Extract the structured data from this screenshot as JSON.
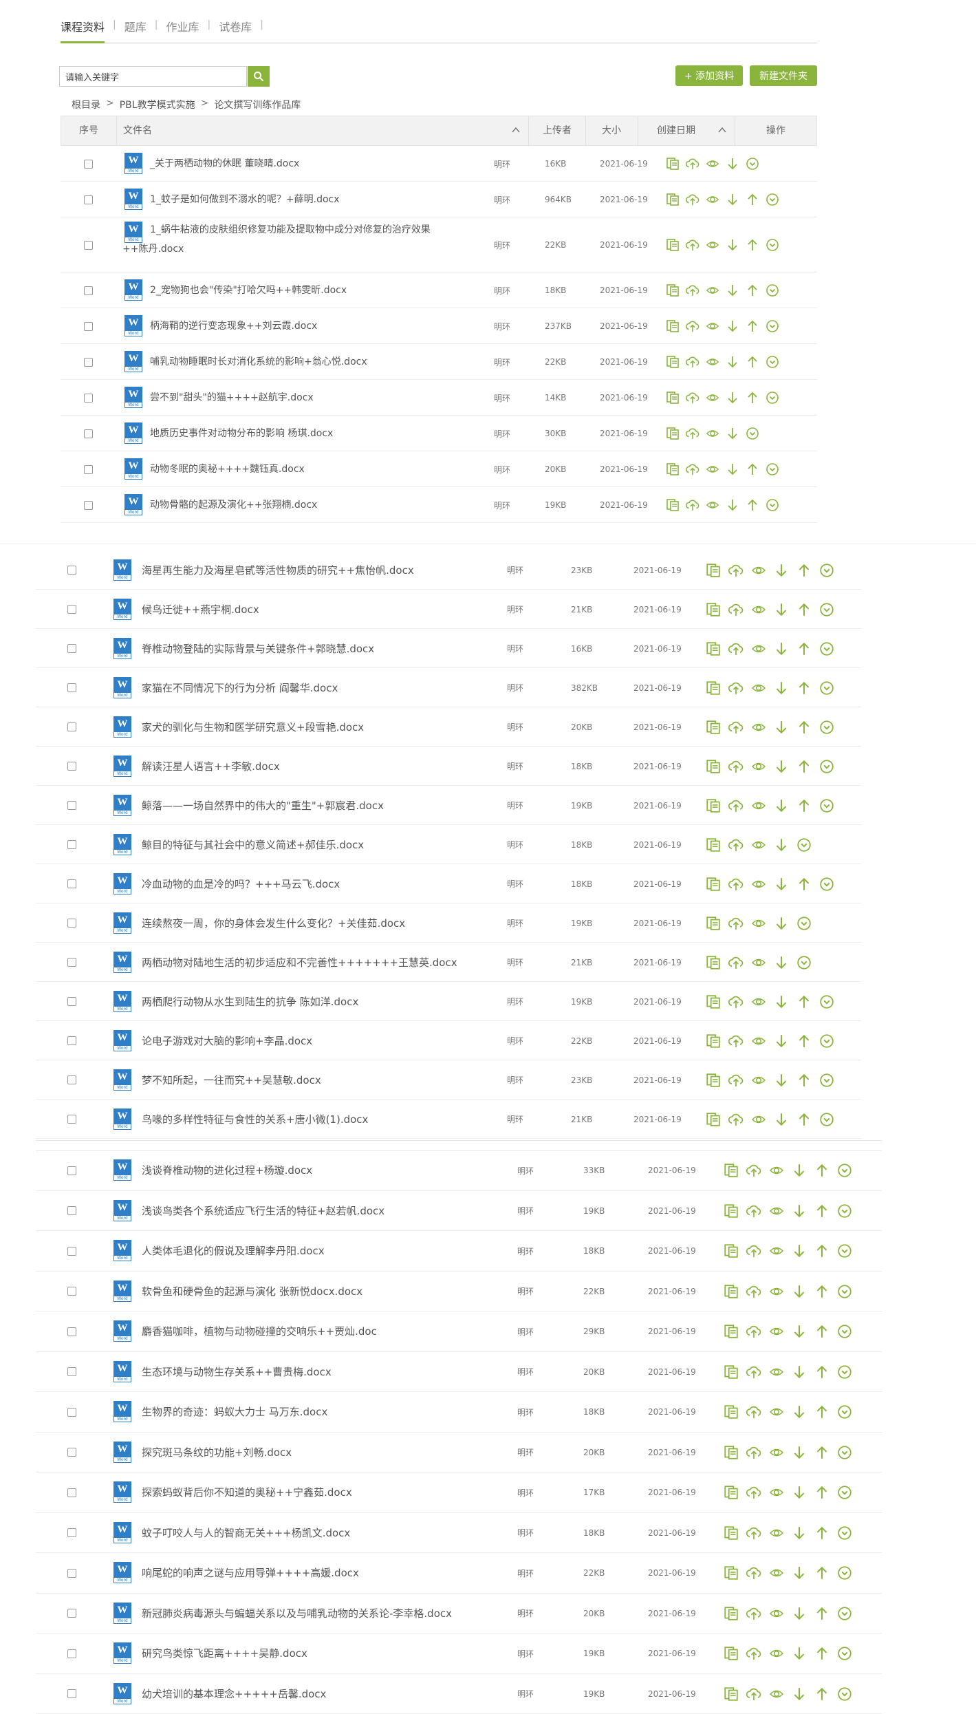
{
  "nav": {
    "tabs": [
      {
        "label": "课程资料",
        "active": true
      },
      {
        "label": "题库",
        "active": false
      },
      {
        "label": "作业库",
        "active": false
      },
      {
        "label": "试卷库",
        "active": false
      }
    ]
  },
  "toolbar": {
    "search_placeholder": "请输入关键字",
    "add_label": "+ 添加资料",
    "new_folder_label": "新建文件夹"
  },
  "breadcrumb": [
    "根目录",
    "PBL教学模式实施",
    "论文撰写训练作品库"
  ],
  "breadcrumb_sep": ">",
  "columns": {
    "index": "序号",
    "name": "文件名",
    "uploader": "上传者",
    "size": "大小",
    "date": "创建日期",
    "ops": "操作"
  },
  "icons": {
    "file": "word-doc-icon",
    "preview_file": "file-preview-icon",
    "upload": "cloud-upload-icon",
    "view": "eye-icon",
    "download": "download-arrow-icon",
    "move_up": "upload-arrow-icon",
    "more": "chevron-circle-icon",
    "search": "search-icon",
    "sort": "sort-caret-icon"
  },
  "colors": {
    "accent": "#8ab43c",
    "word_blue": "#2f7ec8"
  },
  "rows_section1": [
    {
      "name": "_关于两栖动物的休眠 董晓晴.docx",
      "uploader": "明环",
      "size": "16KB",
      "date": "2021-06-19",
      "ops": 5
    },
    {
      "name": "1_蚊子是如何做到不溺水的呢？+薛明.docx",
      "uploader": "明环",
      "size": "964KB",
      "date": "2021-06-19",
      "ops": 6
    },
    {
      "name": "1_蜗牛粘液的皮肤组织修复功能及提取物中成分对修复的治疗效果",
      "name2": "++陈丹.docx",
      "uploader": "明环",
      "size": "22KB",
      "date": "2021-06-19",
      "ops": 6
    },
    {
      "name": "2_宠物狗也会\"传染\"打哈欠吗++韩雯昕.docx",
      "uploader": "明环",
      "size": "18KB",
      "date": "2021-06-19",
      "ops": 6
    },
    {
      "name": "柄海鞘的逆行变态现象++刘云霞.docx",
      "uploader": "明环",
      "size": "237KB",
      "date": "2021-06-19",
      "ops": 6
    },
    {
      "name": "哺乳动物睡眠时长对消化系统的影响+翁心悦.docx",
      "uploader": "明环",
      "size": "22KB",
      "date": "2021-06-19",
      "ops": 6
    },
    {
      "name": "尝不到\"甜头\"的猫++++赵航宇.docx",
      "uploader": "明环",
      "size": "14KB",
      "date": "2021-06-19",
      "ops": 6
    },
    {
      "name": "地质历史事件对动物分布的影响 杨琪.docx",
      "uploader": "明环",
      "size": "30KB",
      "date": "2021-06-19",
      "ops": 5
    },
    {
      "name": "动物冬眠的奥秘++++魏钰真.docx",
      "uploader": "明环",
      "size": "20KB",
      "date": "2021-06-19",
      "ops": 6
    },
    {
      "name": "动物骨骼的起源及演化++张翔楠.docx",
      "uploader": "明环",
      "size": "19KB",
      "date": "2021-06-19",
      "ops": 6
    }
  ],
  "rows_section2": [
    {
      "name": "海星再生能力及海星皂甙等活性物质的研究++焦怡帆.docx",
      "uploader": "明环",
      "size": "23KB",
      "date": "2021-06-19",
      "ops": 6
    },
    {
      "name": "候鸟迁徙++燕宇桐.docx",
      "uploader": "明环",
      "size": "21KB",
      "date": "2021-06-19",
      "ops": 6
    },
    {
      "name": "脊椎动物登陆的实际背景与关键条件+郭晓慧.docx",
      "uploader": "明环",
      "size": "16KB",
      "date": "2021-06-19",
      "ops": 6
    },
    {
      "name": "家猫在不同情况下的行为分析 阎馨华.docx",
      "uploader": "明环",
      "size": "382KB",
      "date": "2021-06-19",
      "ops": 6
    },
    {
      "name": "家犬的驯化与生物和医学研究意义+段雪艳.docx",
      "uploader": "明环",
      "size": "20KB",
      "date": "2021-06-19",
      "ops": 6
    },
    {
      "name": "解读汪星人语言++李敏.docx",
      "uploader": "明环",
      "size": "18KB",
      "date": "2021-06-19",
      "ops": 6
    },
    {
      "name": "鲸落——一场自然界中的伟大的\"重生\"+郭宸君.docx",
      "uploader": "明环",
      "size": "19KB",
      "date": "2021-06-19",
      "ops": 6
    },
    {
      "name": "鲸目的特征与其社会中的意义简述+郝佳乐.docx",
      "uploader": "明环",
      "size": "18KB",
      "date": "2021-06-19",
      "ops": 5
    },
    {
      "name": "冷血动物的血是冷的吗？+++马云飞.docx",
      "uploader": "明环",
      "size": "18KB",
      "date": "2021-06-19",
      "ops": 6
    },
    {
      "name": "连续熬夜一周，你的身体会发生什么变化？+关佳茹.docx",
      "uploader": "明环",
      "size": "19KB",
      "date": "2021-06-19",
      "ops": 5
    },
    {
      "name": "两栖动物对陆地生活的初步适应和不完善性+++++++王慧英.docx",
      "uploader": "明环",
      "size": "21KB",
      "date": "2021-06-19",
      "ops": 5
    },
    {
      "name": "两栖爬行动物从水生到陆生的抗争 陈如洋.docx",
      "uploader": "明环",
      "size": "19KB",
      "date": "2021-06-19",
      "ops": 6
    },
    {
      "name": "论电子游戏对大脑的影响+李晶.docx",
      "uploader": "明环",
      "size": "22KB",
      "date": "2021-06-19",
      "ops": 6
    },
    {
      "name": "梦不知所起，一往而究++吴慧敏.docx",
      "uploader": "明环",
      "size": "23KB",
      "date": "2021-06-19",
      "ops": 6
    },
    {
      "name": "鸟喙的多样性特征与食性的关系+唐小微(1).docx",
      "uploader": "明环",
      "size": "21KB",
      "date": "2021-06-19",
      "ops": 6
    }
  ],
  "rows_section3": [
    {
      "name": "浅谈脊椎动物的进化过程+杨璇.docx",
      "uploader": "明环",
      "size": "33KB",
      "date": "2021-06-19",
      "ops": 6
    },
    {
      "name": "浅谈鸟类各个系统适应飞行生活的特征+赵若帆.docx",
      "uploader": "明环",
      "size": "19KB",
      "date": "2021-06-19",
      "ops": 6
    },
    {
      "name": "人类体毛退化的假说及理解李丹阳.docx",
      "uploader": "明环",
      "size": "18KB",
      "date": "2021-06-19",
      "ops": 6
    },
    {
      "name": "软骨鱼和硬骨鱼的起源与演化 张新悦docx.docx",
      "uploader": "明环",
      "size": "22KB",
      "date": "2021-06-19",
      "ops": 6
    },
    {
      "name": "麝香猫咖啡，植物与动物碰撞的交响乐++贾灿.doc",
      "uploader": "明环",
      "size": "29KB",
      "date": "2021-06-19",
      "ops": 6
    },
    {
      "name": "生态环境与动物生存关系++曹贵梅.docx",
      "uploader": "明环",
      "size": "20KB",
      "date": "2021-06-19",
      "ops": 6
    },
    {
      "name": "生物界的奇迹：蚂蚁大力士 马万东.docx",
      "uploader": "明环",
      "size": "18KB",
      "date": "2021-06-19",
      "ops": 6
    },
    {
      "name": "探究斑马条纹的功能+刘畅.docx",
      "uploader": "明环",
      "size": "20KB",
      "date": "2021-06-19",
      "ops": 6
    },
    {
      "name": "探索蚂蚁背后你不知道的奥秘++宁鑫茹.docx",
      "uploader": "明环",
      "size": "17KB",
      "date": "2021-06-19",
      "ops": 6
    },
    {
      "name": "蚊子叮咬人与人的智商无关+++杨凯文.docx",
      "uploader": "明环",
      "size": "18KB",
      "date": "2021-06-19",
      "ops": 6
    },
    {
      "name": "响尾蛇的响声之谜与应用导弹++++高媛.docx",
      "uploader": "明环",
      "size": "22KB",
      "date": "2021-06-19",
      "ops": 6
    },
    {
      "name": "新冠肺炎病毒源头与蝙蝠关系以及与哺乳动物的关系论-李幸格.docx",
      "uploader": "明环",
      "size": "20KB",
      "date": "2021-06-19",
      "ops": 6
    },
    {
      "name": "研究鸟类惊飞距离++++吴静.docx",
      "uploader": "明环",
      "size": "19KB",
      "date": "2021-06-19",
      "ops": 6
    },
    {
      "name": "幼犬培训的基本理念+++++岳馨.docx",
      "uploader": "明环",
      "size": "19KB",
      "date": "2021-06-19",
      "ops": 6
    }
  ]
}
